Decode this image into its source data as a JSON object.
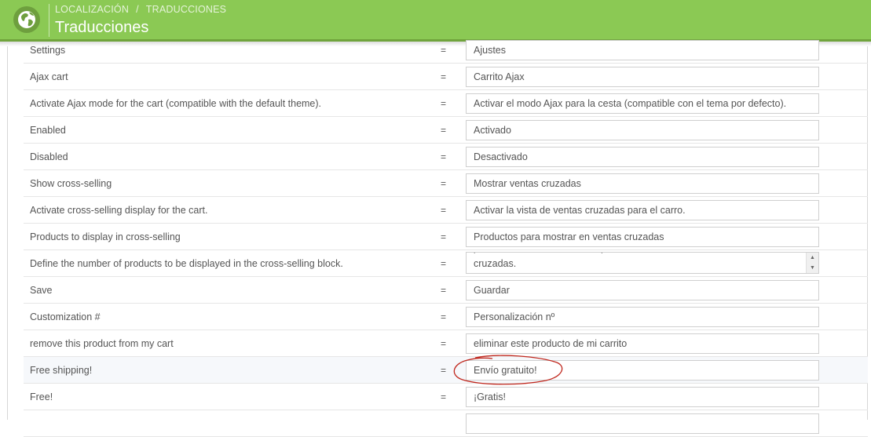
{
  "header": {
    "breadcrumb_1": "LOCALIZACIÓN",
    "breadcrumb_sep": "/",
    "breadcrumb_2": "TRADUCCIONES",
    "title": "Traducciones",
    "accent_color": "#8bc954"
  },
  "equals": "=",
  "rows": [
    {
      "source": "Settings",
      "translation": "Ajustes"
    },
    {
      "source": "Ajax cart",
      "translation": "Carrito Ajax"
    },
    {
      "source": "Activate Ajax mode for the cart (compatible with the default theme).",
      "translation": "Activar el modo Ajax para la cesta (compatible con el tema por defecto)."
    },
    {
      "source": "Enabled",
      "translation": "Activado"
    },
    {
      "source": "Disabled",
      "translation": "Desactivado"
    },
    {
      "source": "Show cross-selling",
      "translation": "Mostrar ventas cruzadas"
    },
    {
      "source": "Activate cross-selling display for the cart.",
      "translation": "Activar la vista de ventas cruzadas para el carro."
    },
    {
      "source": "Products to display in cross-selling",
      "translation": "Productos para mostrar en ventas cruzadas"
    },
    {
      "source": "Define the number of products to be displayed in the cross-selling block.",
      "translation": "cruzadas."
    },
    {
      "source": "Save",
      "translation": "Guardar"
    },
    {
      "source": "Customization #",
      "translation": "Personalización nº"
    },
    {
      "source": "remove this product from my cart",
      "translation": "eliminar este producto de mi carrito"
    },
    {
      "source": "Free shipping!",
      "translation": "Envío gratuito!"
    },
    {
      "source": "Free!",
      "translation": "¡Gratis!"
    },
    {
      "source": "",
      "translation": ""
    }
  ]
}
